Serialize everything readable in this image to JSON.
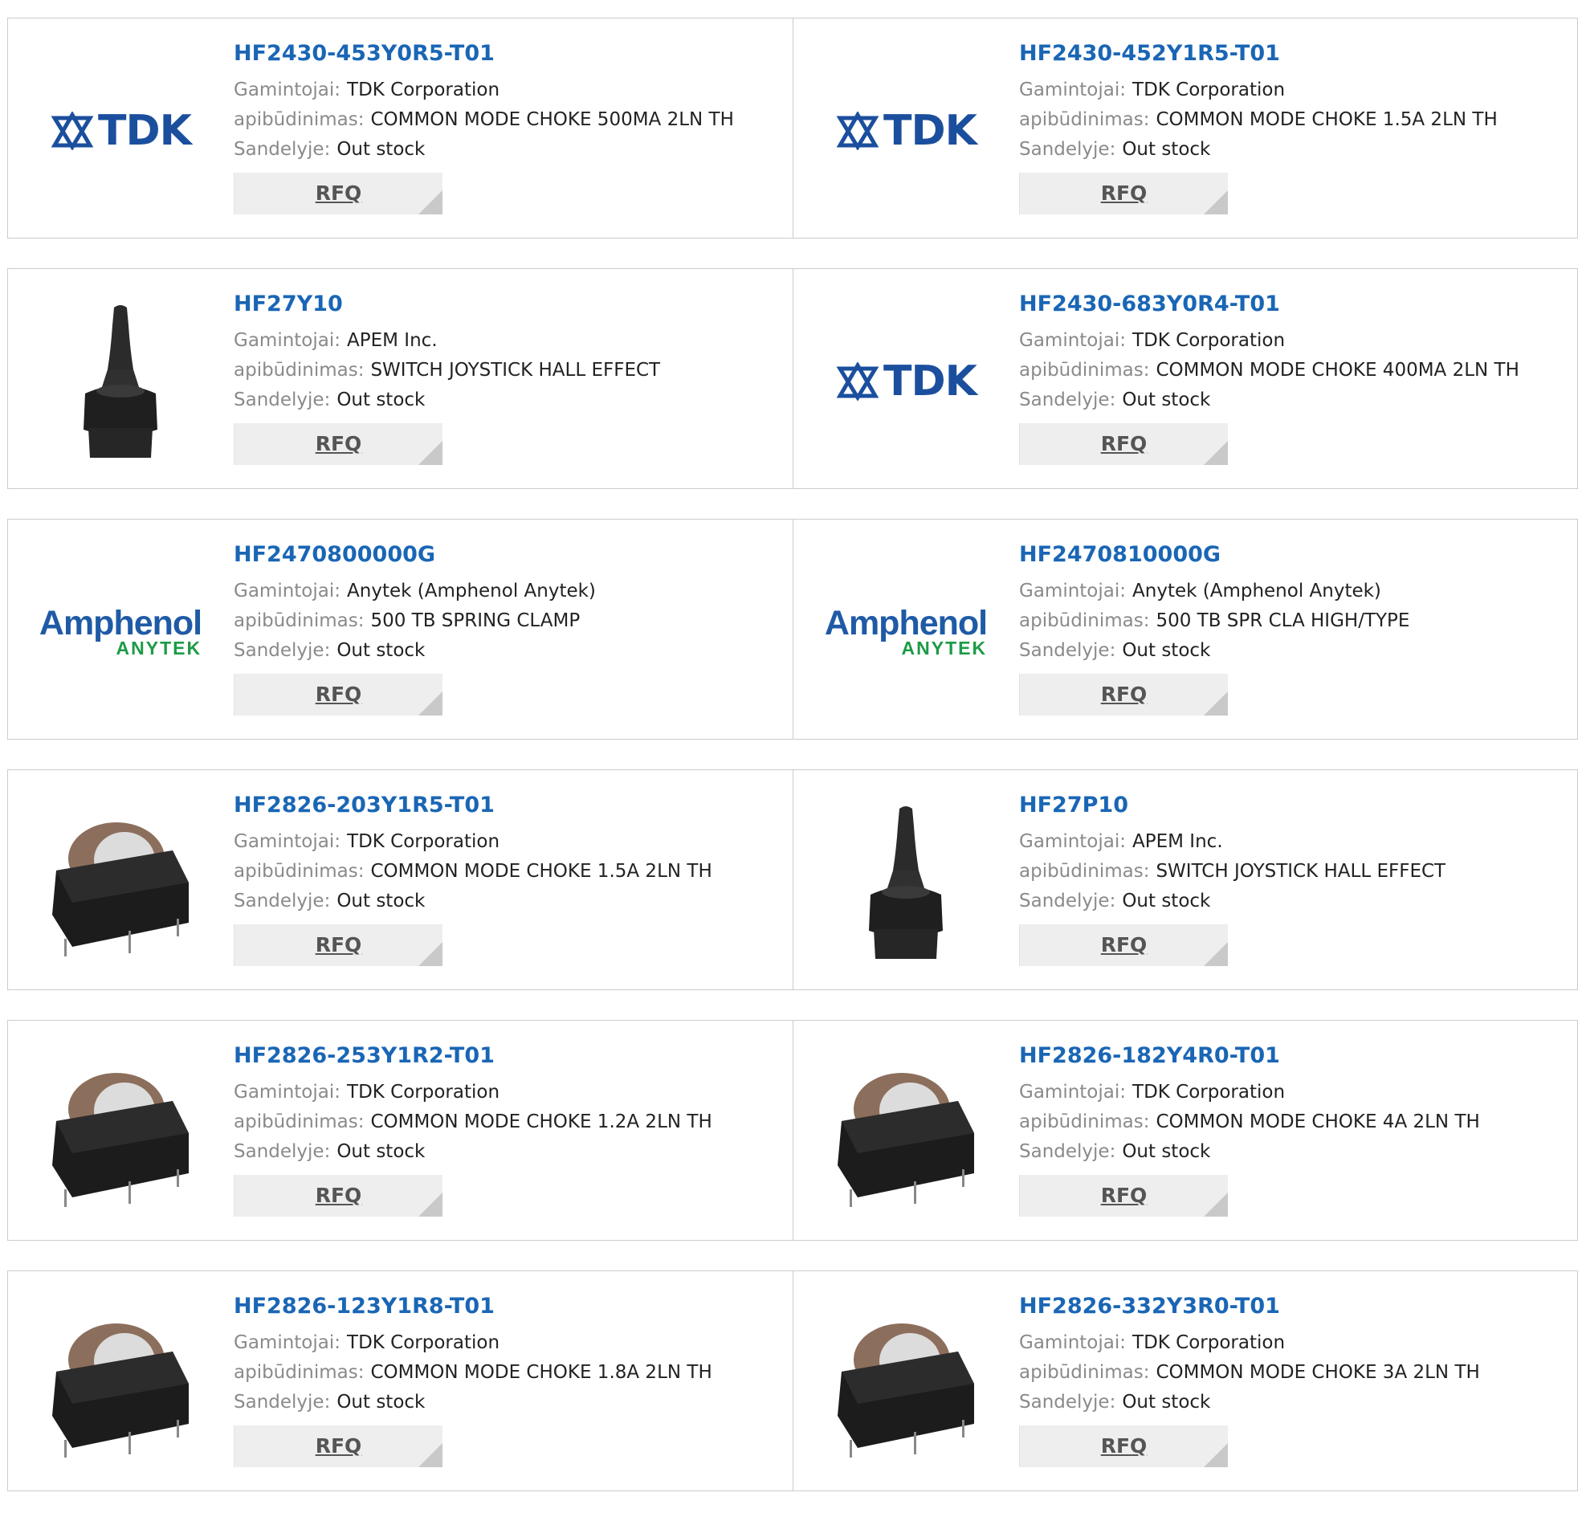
{
  "labels": {
    "manufacturer": "Gamintojai:",
    "description": "apibūdinimas:",
    "stock": "Sandelyje:",
    "rfq": "RFQ"
  },
  "products": [
    {
      "part": "HF2430-453Y0R5-T01",
      "manufacturer": "TDK Corporation",
      "description": "COMMON MODE CHOKE 500MA 2LN TH",
      "stock": "Out stock",
      "image": "tdk-logo"
    },
    {
      "part": "HF2430-452Y1R5-T01",
      "manufacturer": "TDK Corporation",
      "description": "COMMON MODE CHOKE 1.5A 2LN TH",
      "stock": "Out stock",
      "image": "tdk-logo"
    },
    {
      "part": "HF27Y10",
      "manufacturer": "APEM Inc.",
      "description": "SWITCH JOYSTICK HALL EFFECT",
      "stock": "Out stock",
      "image": "joystick-photo"
    },
    {
      "part": "HF2430-683Y0R4-T01",
      "manufacturer": "TDK Corporation",
      "description": "COMMON MODE CHOKE 400MA 2LN TH",
      "stock": "Out stock",
      "image": "tdk-logo"
    },
    {
      "part": "HF2470800000G",
      "manufacturer": "Anytek (Amphenol Anytek)",
      "description": "500 TB SPRING CLAMP",
      "stock": "Out stock",
      "image": "amphenol-logo"
    },
    {
      "part": "HF2470810000G",
      "manufacturer": "Anytek (Amphenol Anytek)",
      "description": "500 TB SPR CLA HIGH/TYPE",
      "stock": "Out stock",
      "image": "amphenol-logo"
    },
    {
      "part": "HF2826-203Y1R5-T01",
      "manufacturer": "TDK Corporation",
      "description": "COMMON MODE CHOKE 1.5A 2LN TH",
      "stock": "Out stock",
      "image": "choke-photo"
    },
    {
      "part": "HF27P10",
      "manufacturer": "APEM Inc.",
      "description": "SWITCH JOYSTICK HALL EFFECT",
      "stock": "Out stock",
      "image": "joystick-photo"
    },
    {
      "part": "HF2826-253Y1R2-T01",
      "manufacturer": "TDK Corporation",
      "description": "COMMON MODE CHOKE 1.2A 2LN TH",
      "stock": "Out stock",
      "image": "choke-photo"
    },
    {
      "part": "HF2826-182Y4R0-T01",
      "manufacturer": "TDK Corporation",
      "description": "COMMON MODE CHOKE 4A 2LN TH",
      "stock": "Out stock",
      "image": "choke-photo"
    },
    {
      "part": "HF2826-123Y1R8-T01",
      "manufacturer": "TDK Corporation",
      "description": "COMMON MODE CHOKE 1.8A 2LN TH",
      "stock": "Out stock",
      "image": "choke-photo"
    },
    {
      "part": "HF2826-332Y3R0-T01",
      "manufacturer": "TDK Corporation",
      "description": "COMMON MODE CHOKE 3A 2LN TH",
      "stock": "Out stock",
      "image": "choke-photo"
    }
  ],
  "logos": {
    "tdk": "TDK",
    "amphenol_top": "Amphenol",
    "amphenol_bottom": "ANYTEK"
  },
  "colors": {
    "link": "#1a66b5",
    "tdk_blue": "#1b4f9e",
    "amphenol_blue": "#1f5aa6",
    "amphenol_green": "#1c9b47"
  }
}
